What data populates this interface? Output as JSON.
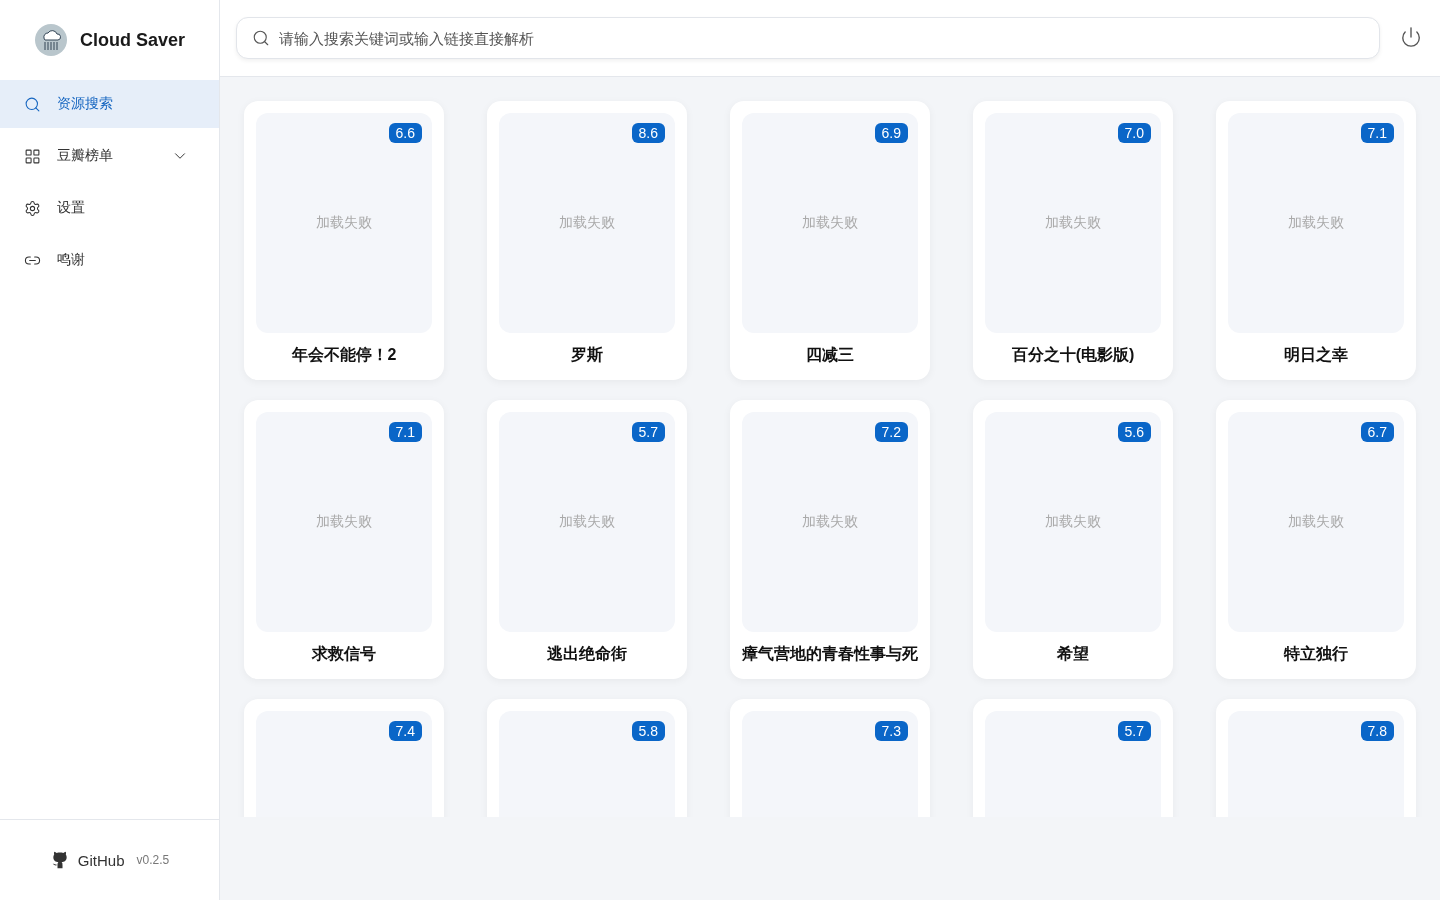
{
  "app": {
    "title": "Cloud Saver"
  },
  "sidebar": {
    "items": [
      {
        "label": "资源搜索",
        "kind": "search",
        "selected": true
      },
      {
        "label": "豆瓣榜单",
        "kind": "ranking",
        "selected": false,
        "expanded": false
      },
      {
        "label": "设置",
        "kind": "settings",
        "selected": false
      },
      {
        "label": "鸣谢",
        "kind": "thanks",
        "selected": false
      }
    ],
    "footer": {
      "link": "GitHub",
      "version": "v0.2.5"
    }
  },
  "search": {
    "placeholder": "请输入搜索关键词或输入链接直接解析"
  },
  "movies": [
    {
      "rating": "6.6",
      "poster_text": "加载失败",
      "title": "年会不能停！2"
    },
    {
      "rating": "8.6",
      "poster_text": "加载失败",
      "title": "罗斯"
    },
    {
      "rating": "6.9",
      "poster_text": "加载失败",
      "title": "四减三"
    },
    {
      "rating": "7.0",
      "poster_text": "加载失败",
      "title": "百分之十(电影版)"
    },
    {
      "rating": "7.1",
      "poster_text": "加载失败",
      "title": "明日之幸"
    },
    {
      "rating": "7.1",
      "poster_text": "加载失败",
      "title": "求救信号"
    },
    {
      "rating": "5.7",
      "poster_text": "加载失败",
      "title": "逃出绝命街"
    },
    {
      "rating": "7.2",
      "poster_text": "加载失败",
      "title": "瘴气营地的青春性事与死"
    },
    {
      "rating": "5.6",
      "poster_text": "加载失败",
      "title": "希望"
    },
    {
      "rating": "6.7",
      "poster_text": "加载失败",
      "title": "特立独行"
    },
    {
      "rating": "7.4"
    },
    {
      "rating": "5.8"
    },
    {
      "rating": "7.3"
    },
    {
      "rating": "5.7"
    },
    {
      "rating": "7.8"
    }
  ]
}
